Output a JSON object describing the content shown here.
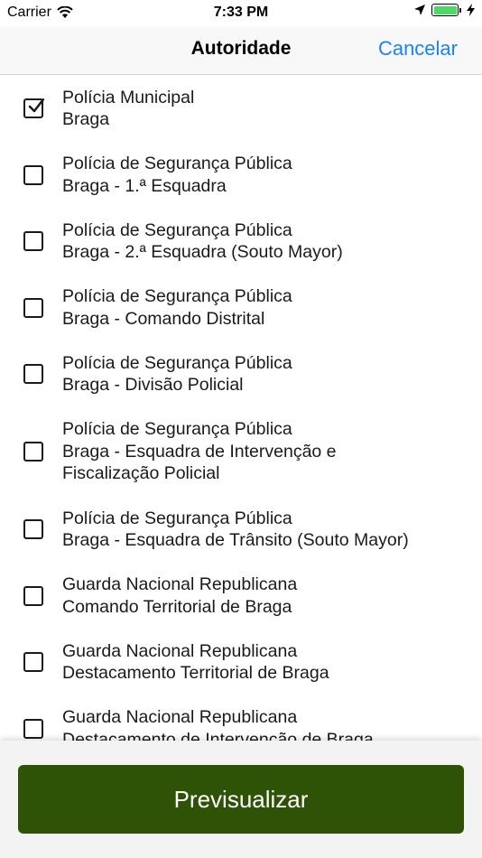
{
  "status_bar": {
    "carrier": "Carrier",
    "time": "7:33 PM",
    "wifi_icon": "wifi-icon",
    "location_icon": "location-arrow-icon",
    "battery_icon": "battery-icon",
    "charging_icon": "bolt-icon",
    "battery_color": "#4cd964"
  },
  "nav": {
    "title": "Autoridade",
    "cancel_label": "Cancelar",
    "accent_color": "#1a82fb"
  },
  "items": [
    {
      "line1": "Polícia Municipal",
      "line2": "Braga",
      "line3": "",
      "checked": true
    },
    {
      "line1": "Polícia de Segurança Pública",
      "line2": "Braga - 1.ª Esquadra",
      "line3": "",
      "checked": false
    },
    {
      "line1": "Polícia de Segurança Pública",
      "line2": "Braga - 2.ª Esquadra (Souto Mayor)",
      "line3": "",
      "checked": false
    },
    {
      "line1": "Polícia de Segurança Pública",
      "line2": "Braga - Comando Distrital",
      "line3": "",
      "checked": false
    },
    {
      "line1": "Polícia de Segurança Pública",
      "line2": "Braga - Divisão Policial",
      "line3": "",
      "checked": false
    },
    {
      "line1": "Polícia de Segurança Pública",
      "line2": "Braga - Esquadra de Intervenção e",
      "line3": "Fiscalização Policial",
      "checked": false
    },
    {
      "line1": "Polícia de Segurança Pública",
      "line2": "Braga - Esquadra de Trânsito (Souto Mayor)",
      "line3": "",
      "checked": false
    },
    {
      "line1": "Guarda Nacional Republicana",
      "line2": "Comando Territorial de Braga",
      "line3": "",
      "checked": false
    },
    {
      "line1": "Guarda Nacional Republicana",
      "line2": "Destacamento Territorial de Braga",
      "line3": "",
      "checked": false
    },
    {
      "line1": "Guarda Nacional Republicana",
      "line2": "Destacamento de Intervenção de Braga",
      "line3": "",
      "checked": false
    }
  ],
  "footer": {
    "preview_label": "Previsualizar",
    "button_color": "#2e5306"
  }
}
